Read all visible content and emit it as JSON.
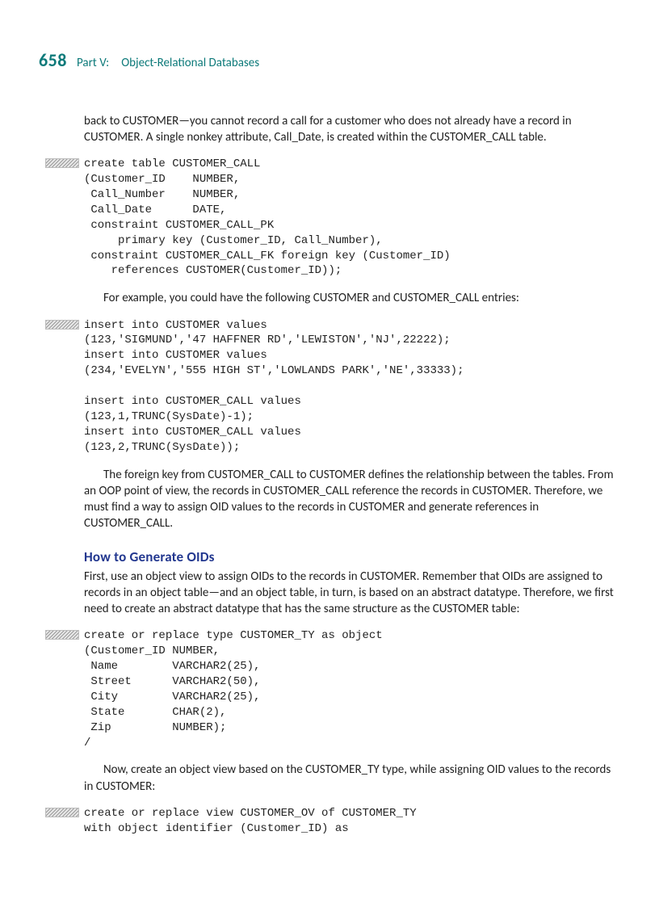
{
  "header": {
    "page_number": "658",
    "running_title": "Part V: Object-Relational Databases"
  },
  "para1": "back to CUSTOMER—you cannot record a call for a customer who does not already have a record in CUSTOMER. A single nonkey attribute, Call_Date, is created within the CUSTOMER_CALL table.",
  "code1": "create table CUSTOMER_CALL\n(Customer_ID    NUMBER,\n Call_Number    NUMBER,\n Call_Date      DATE,\n constraint CUSTOMER_CALL_PK\n     primary key (Customer_ID, Call_Number),\n constraint CUSTOMER_CALL_FK foreign key (Customer_ID)\n    references CUSTOMER(Customer_ID));",
  "para2": "For example, you could have the following CUSTOMER and CUSTOMER_CALL entries:",
  "code2": "insert into CUSTOMER values\n(123,'SIGMUND','47 HAFFNER RD','LEWISTON','NJ',22222);\ninsert into CUSTOMER values\n(234,'EVELYN','555 HIGH ST','LOWLANDS PARK','NE',33333);\n\ninsert into CUSTOMER_CALL values\n(123,1,TRUNC(SysDate)-1);\ninsert into CUSTOMER_CALL values\n(123,2,TRUNC(SysDate));",
  "para3": "The foreign key from CUSTOMER_CALL to CUSTOMER defines the relationship between the tables. From an OOP point of view, the records in CUSTOMER_CALL reference the records in CUSTOMER. Therefore, we must find a way to assign OID values to the records in CUSTOMER and generate references in CUSTOMER_CALL.",
  "section_heading": "How to Generate OIDs",
  "para4": "First, use an object view to assign OIDs to the records in CUSTOMER. Remember that OIDs are assigned to records in an object table—and an object table, in turn, is based on an abstract datatype. Therefore, we first need to create an abstract datatype that has the same structure as the CUSTOMER table:",
  "code3": "create or replace type CUSTOMER_TY as object\n(Customer_ID NUMBER,\n Name        VARCHAR2(25),\n Street      VARCHAR2(50),\n City        VARCHAR2(25),\n State       CHAR(2),\n Zip         NUMBER);\n/",
  "para5": "Now, create an object view based on the CUSTOMER_TY type, while assigning OID values to the records in CUSTOMER:",
  "code4": "create or replace view CUSTOMER_OV of CUSTOMER_TY\nwith object identifier (Customer_ID) as"
}
